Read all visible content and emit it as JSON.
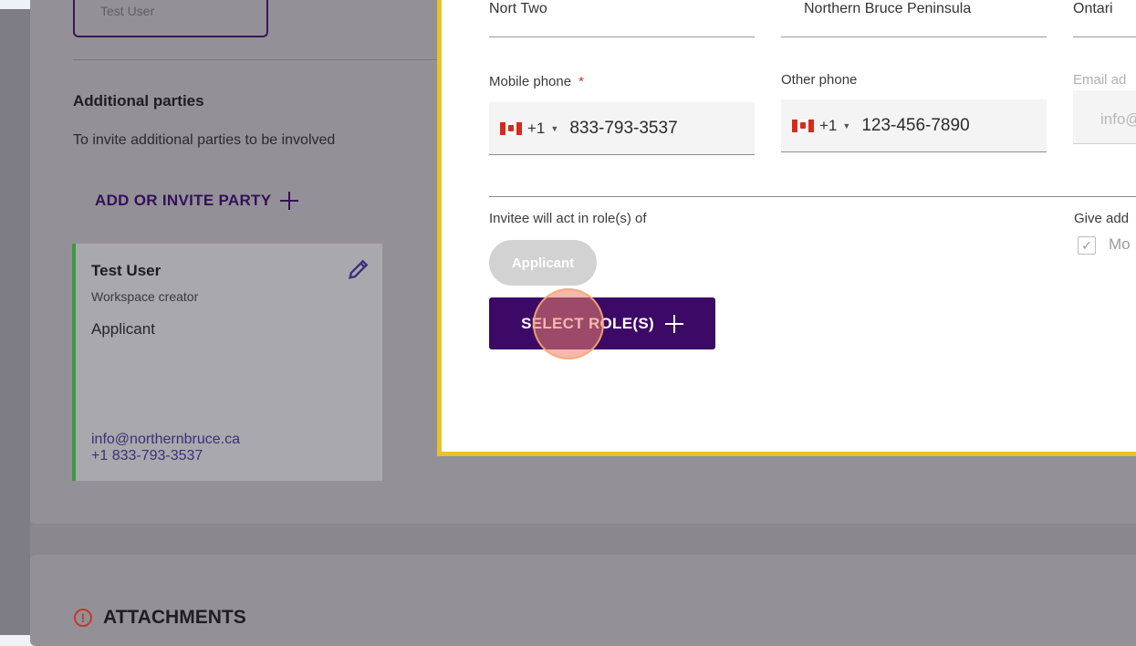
{
  "background_form": {
    "previous_field_value": "Test User",
    "additional_parties": {
      "heading": "Additional parties",
      "description": "To invite additional parties to be involved",
      "add_button_label": "ADD OR INVITE PARTY"
    },
    "party_card": {
      "name": "Test User",
      "subtitle": "Workspace creator",
      "role": "Applicant",
      "email": "info@northernbruce.ca",
      "phone": "+1 833-793-3537"
    },
    "attachments_heading": "ATTACHMENTS"
  },
  "modal": {
    "partial_row_values": [
      "Nort Two",
      "Northern Bruce Peninsula",
      "Ontari"
    ],
    "mobile_phone": {
      "label": "Mobile phone",
      "required_mark": "*",
      "country_code": "+1",
      "number": "833-793-3537"
    },
    "other_phone": {
      "label": "Other phone",
      "country_code": "+1",
      "number": "123-456-7890"
    },
    "email": {
      "label": "Email ad",
      "value": "info@"
    },
    "roles": {
      "label": "Invitee will act in role(s) of",
      "chips": [
        "Applicant"
      ],
      "select_button_label": "SELECT ROLE(S)"
    },
    "additional_access": {
      "label": "Give add",
      "checkbox_label": "Mo",
      "checked": true
    }
  },
  "colors": {
    "modal_border": "#e9c12b",
    "primary_button": "#3c0a66",
    "party_accent": "#3c9a3c",
    "required": "#d6302b"
  }
}
